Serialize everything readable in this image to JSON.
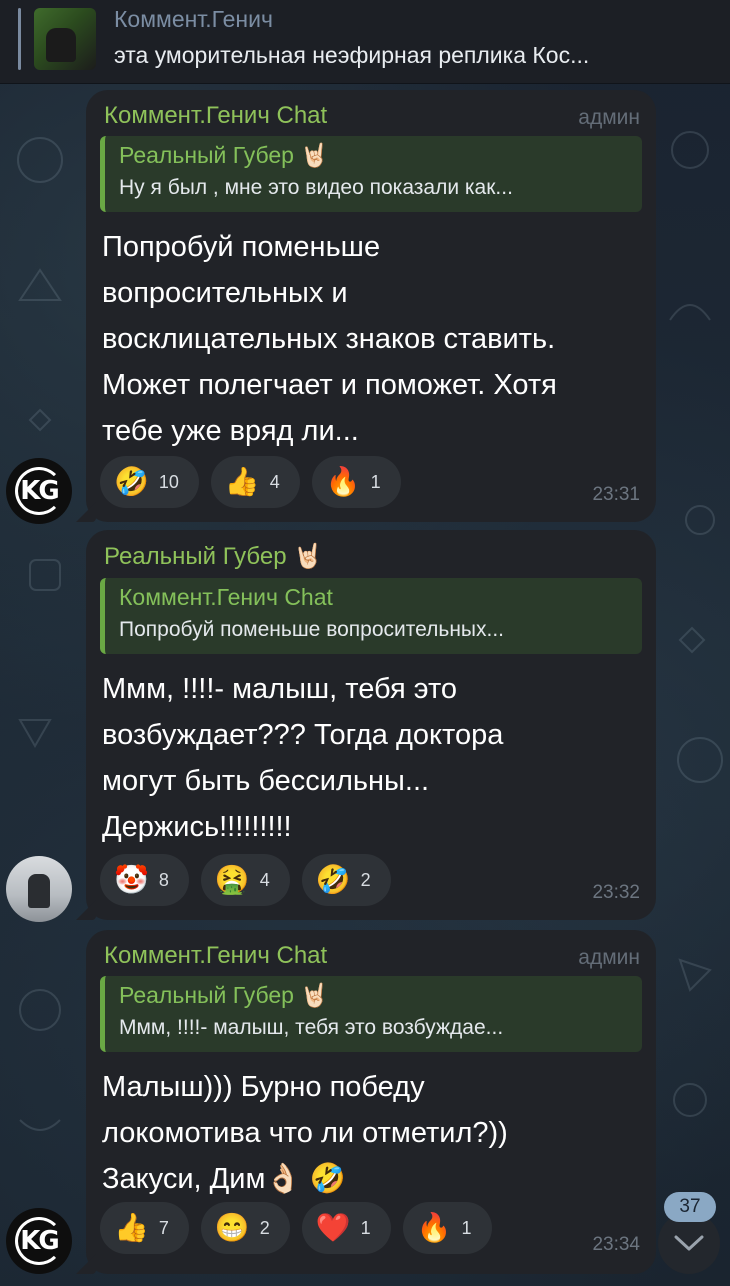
{
  "pinned": {
    "title": "Коммент.Генич",
    "text": "эта уморительная неэфирная реплика Кос..."
  },
  "messages": [
    {
      "sender": "Коммент.Генич Chat",
      "badge": "админ",
      "reply_name": "Реальный Губер 🤘🏻",
      "reply_text": "Ну я был , мне это видео показали как...",
      "lines": [
        "Попробуй поменьше",
        "вопросительных и",
        "восклицательных знаков ставить.",
        "Может полегчает и поможет. Хотя",
        "тебе уже вряд ли..."
      ],
      "reactions": [
        {
          "emoji": "🤣",
          "count": "10"
        },
        {
          "emoji": "👍",
          "count": "4"
        },
        {
          "emoji": "🔥",
          "count": "1"
        }
      ],
      "time": "23:31",
      "avatar_text": "KG"
    },
    {
      "sender": "Реальный Губер 🤘🏻",
      "badge": "",
      "reply_name": "Коммент.Генич Chat",
      "reply_text": "Попробуй поменьше вопросительных...",
      "lines": [
        "Ммм, !!!!- малыш, тебя это",
        "возбуждает??? Тогда доктора",
        "могут быть бессильны...",
        "Держись!!!!!!!!!"
      ],
      "reactions": [
        {
          "emoji": "🤡",
          "count": "8"
        },
        {
          "emoji": "🤮",
          "count": "4"
        },
        {
          "emoji": "🤣",
          "count": "2"
        }
      ],
      "time": "23:32"
    },
    {
      "sender": "Коммент.Генич Chat",
      "badge": "админ",
      "reply_name": "Реальный Губер 🤘🏻",
      "reply_text": "Ммм, !!!!- малыш, тебя это возбуждае...",
      "lines": [
        "Малыш))) Бурно победу",
        "локомотива что ли отметил?))",
        "Закуси, Дим👌🏻 🤣"
      ],
      "reactions": [
        {
          "emoji": "👍",
          "count": "7"
        },
        {
          "emoji": "😁",
          "count": "2"
        },
        {
          "emoji": "❤️",
          "count": "1"
        },
        {
          "emoji": "🔥",
          "count": "1"
        }
      ],
      "time": "23:34",
      "avatar_text": "KG"
    }
  ],
  "unread_count": "37",
  "icons": {
    "scroll_down": "chevron-down-icon"
  }
}
